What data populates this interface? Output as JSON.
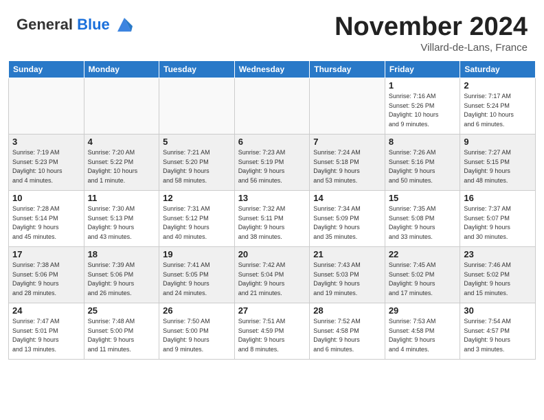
{
  "header": {
    "logo_general": "General",
    "logo_blue": "Blue",
    "month_title": "November 2024",
    "location": "Villard-de-Lans, France"
  },
  "calendar": {
    "headers": [
      "Sunday",
      "Monday",
      "Tuesday",
      "Wednesday",
      "Thursday",
      "Friday",
      "Saturday"
    ],
    "weeks": [
      {
        "days": [
          {
            "num": "",
            "info": "",
            "empty": true
          },
          {
            "num": "",
            "info": "",
            "empty": true
          },
          {
            "num": "",
            "info": "",
            "empty": true
          },
          {
            "num": "",
            "info": "",
            "empty": true
          },
          {
            "num": "",
            "info": "",
            "empty": true
          },
          {
            "num": "1",
            "info": "Sunrise: 7:16 AM\nSunset: 5:26 PM\nDaylight: 10 hours\nand 9 minutes.",
            "empty": false
          },
          {
            "num": "2",
            "info": "Sunrise: 7:17 AM\nSunset: 5:24 PM\nDaylight: 10 hours\nand 6 minutes.",
            "empty": false
          }
        ]
      },
      {
        "days": [
          {
            "num": "3",
            "info": "Sunrise: 7:19 AM\nSunset: 5:23 PM\nDaylight: 10 hours\nand 4 minutes.",
            "empty": false
          },
          {
            "num": "4",
            "info": "Sunrise: 7:20 AM\nSunset: 5:22 PM\nDaylight: 10 hours\nand 1 minute.",
            "empty": false
          },
          {
            "num": "5",
            "info": "Sunrise: 7:21 AM\nSunset: 5:20 PM\nDaylight: 9 hours\nand 58 minutes.",
            "empty": false
          },
          {
            "num": "6",
            "info": "Sunrise: 7:23 AM\nSunset: 5:19 PM\nDaylight: 9 hours\nand 56 minutes.",
            "empty": false
          },
          {
            "num": "7",
            "info": "Sunrise: 7:24 AM\nSunset: 5:18 PM\nDaylight: 9 hours\nand 53 minutes.",
            "empty": false
          },
          {
            "num": "8",
            "info": "Sunrise: 7:26 AM\nSunset: 5:16 PM\nDaylight: 9 hours\nand 50 minutes.",
            "empty": false
          },
          {
            "num": "9",
            "info": "Sunrise: 7:27 AM\nSunset: 5:15 PM\nDaylight: 9 hours\nand 48 minutes.",
            "empty": false
          }
        ]
      },
      {
        "days": [
          {
            "num": "10",
            "info": "Sunrise: 7:28 AM\nSunset: 5:14 PM\nDaylight: 9 hours\nand 45 minutes.",
            "empty": false
          },
          {
            "num": "11",
            "info": "Sunrise: 7:30 AM\nSunset: 5:13 PM\nDaylight: 9 hours\nand 43 minutes.",
            "empty": false
          },
          {
            "num": "12",
            "info": "Sunrise: 7:31 AM\nSunset: 5:12 PM\nDaylight: 9 hours\nand 40 minutes.",
            "empty": false
          },
          {
            "num": "13",
            "info": "Sunrise: 7:32 AM\nSunset: 5:11 PM\nDaylight: 9 hours\nand 38 minutes.",
            "empty": false
          },
          {
            "num": "14",
            "info": "Sunrise: 7:34 AM\nSunset: 5:09 PM\nDaylight: 9 hours\nand 35 minutes.",
            "empty": false
          },
          {
            "num": "15",
            "info": "Sunrise: 7:35 AM\nSunset: 5:08 PM\nDaylight: 9 hours\nand 33 minutes.",
            "empty": false
          },
          {
            "num": "16",
            "info": "Sunrise: 7:37 AM\nSunset: 5:07 PM\nDaylight: 9 hours\nand 30 minutes.",
            "empty": false
          }
        ]
      },
      {
        "days": [
          {
            "num": "17",
            "info": "Sunrise: 7:38 AM\nSunset: 5:06 PM\nDaylight: 9 hours\nand 28 minutes.",
            "empty": false
          },
          {
            "num": "18",
            "info": "Sunrise: 7:39 AM\nSunset: 5:06 PM\nDaylight: 9 hours\nand 26 minutes.",
            "empty": false
          },
          {
            "num": "19",
            "info": "Sunrise: 7:41 AM\nSunset: 5:05 PM\nDaylight: 9 hours\nand 24 minutes.",
            "empty": false
          },
          {
            "num": "20",
            "info": "Sunrise: 7:42 AM\nSunset: 5:04 PM\nDaylight: 9 hours\nand 21 minutes.",
            "empty": false
          },
          {
            "num": "21",
            "info": "Sunrise: 7:43 AM\nSunset: 5:03 PM\nDaylight: 9 hours\nand 19 minutes.",
            "empty": false
          },
          {
            "num": "22",
            "info": "Sunrise: 7:45 AM\nSunset: 5:02 PM\nDaylight: 9 hours\nand 17 minutes.",
            "empty": false
          },
          {
            "num": "23",
            "info": "Sunrise: 7:46 AM\nSunset: 5:02 PM\nDaylight: 9 hours\nand 15 minutes.",
            "empty": false
          }
        ]
      },
      {
        "days": [
          {
            "num": "24",
            "info": "Sunrise: 7:47 AM\nSunset: 5:01 PM\nDaylight: 9 hours\nand 13 minutes.",
            "empty": false
          },
          {
            "num": "25",
            "info": "Sunrise: 7:48 AM\nSunset: 5:00 PM\nDaylight: 9 hours\nand 11 minutes.",
            "empty": false
          },
          {
            "num": "26",
            "info": "Sunrise: 7:50 AM\nSunset: 5:00 PM\nDaylight: 9 hours\nand 9 minutes.",
            "empty": false
          },
          {
            "num": "27",
            "info": "Sunrise: 7:51 AM\nSunset: 4:59 PM\nDaylight: 9 hours\nand 8 minutes.",
            "empty": false
          },
          {
            "num": "28",
            "info": "Sunrise: 7:52 AM\nSunset: 4:58 PM\nDaylight: 9 hours\nand 6 minutes.",
            "empty": false
          },
          {
            "num": "29",
            "info": "Sunrise: 7:53 AM\nSunset: 4:58 PM\nDaylight: 9 hours\nand 4 minutes.",
            "empty": false
          },
          {
            "num": "30",
            "info": "Sunrise: 7:54 AM\nSunset: 4:57 PM\nDaylight: 9 hours\nand 3 minutes.",
            "empty": false
          }
        ]
      }
    ]
  }
}
